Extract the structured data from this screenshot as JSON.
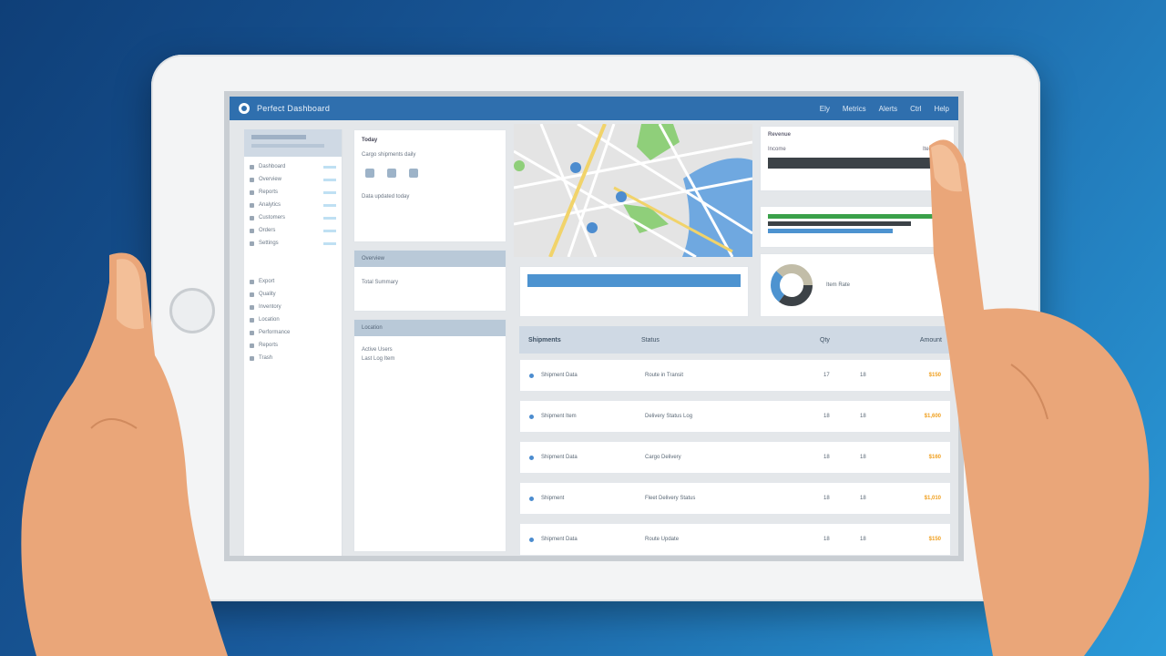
{
  "app": {
    "title": "Perfect Dashboard"
  },
  "top_nav": [
    "Ely",
    "Metrics",
    "Alerts",
    "Ctrl",
    "Help"
  ],
  "sidebar": {
    "items": [
      "Dashboard",
      "Overview",
      "Reports",
      "Analytics",
      "Customers",
      "Orders",
      "Settings",
      "Export",
      "Quality",
      "Inventory",
      "Location",
      "Performance",
      "Reports",
      "Trash"
    ]
  },
  "mid": {
    "card1_title": "Today",
    "card1_line": "Cargo shipments daily",
    "card1_footer": "Data updated today",
    "card2_title": "Overview",
    "card2_line": "Total Summary",
    "card3_title": "Location",
    "card3_line1": "Active Users",
    "card3_line2": "Last Log Item"
  },
  "summary": {
    "title": "Revenue",
    "left": "Income",
    "right": "Item Rate"
  },
  "table": {
    "headers": [
      "Shipments",
      "Status",
      "Qty",
      "Amount"
    ],
    "rows": [
      {
        "name": "Shipment Data",
        "desc": "Route in Transit",
        "qty": "17",
        "n": "18",
        "amount": "$150"
      },
      {
        "name": "Shipment Item",
        "desc": "Delivery Status Log",
        "qty": "18",
        "n": "18",
        "amount": "$1,600"
      },
      {
        "name": "Shipment Data",
        "desc": "Cargo Delivery",
        "qty": "18",
        "n": "18",
        "amount": "$160"
      },
      {
        "name": "Shipment",
        "desc": "Fleet Delivery Status",
        "qty": "18",
        "n": "18",
        "amount": "$1,010"
      },
      {
        "name": "Shipment Data",
        "desc": "Route Update",
        "qty": "18",
        "n": "18",
        "amount": "$150"
      }
    ]
  },
  "colors": {
    "accent": "#2f6fae",
    "amount": "#f0a020",
    "background": "#1a5c9e"
  }
}
